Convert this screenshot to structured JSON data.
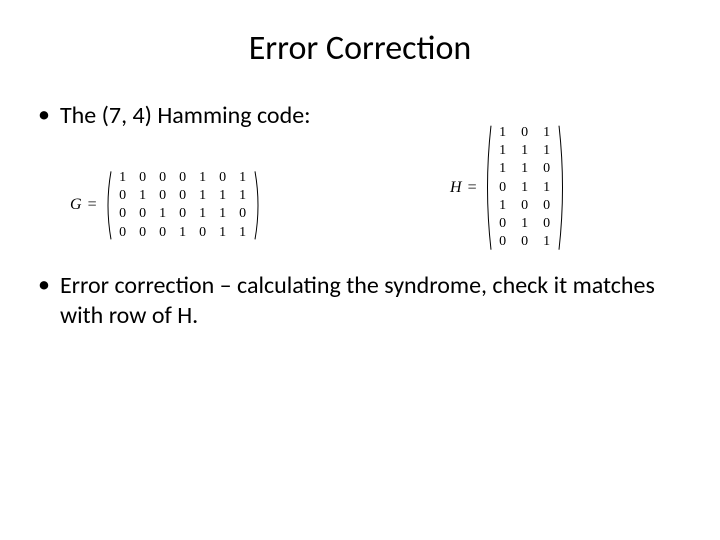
{
  "title": "Error Correction",
  "bullets": {
    "first": "The (7, 4) Hamming code:",
    "second": "Error correction – calculating the syndrome, check it matches with row of H."
  },
  "matrices": {
    "G": {
      "label": "G",
      "equals": "=",
      "rows": [
        [
          "1",
          "0",
          "0",
          "0",
          "1",
          "0",
          "1"
        ],
        [
          "0",
          "1",
          "0",
          "0",
          "1",
          "1",
          "1"
        ],
        [
          "0",
          "0",
          "1",
          "0",
          "1",
          "1",
          "0"
        ],
        [
          "0",
          "0",
          "0",
          "1",
          "0",
          "1",
          "1"
        ]
      ]
    },
    "H": {
      "label": "H",
      "equals": "=",
      "rows": [
        [
          "1",
          "0",
          "1"
        ],
        [
          "1",
          "1",
          "1"
        ],
        [
          "1",
          "1",
          "0"
        ],
        [
          "0",
          "1",
          "1"
        ],
        [
          "1",
          "0",
          "0"
        ],
        [
          "0",
          "1",
          "0"
        ],
        [
          "0",
          "0",
          "1"
        ]
      ]
    }
  }
}
